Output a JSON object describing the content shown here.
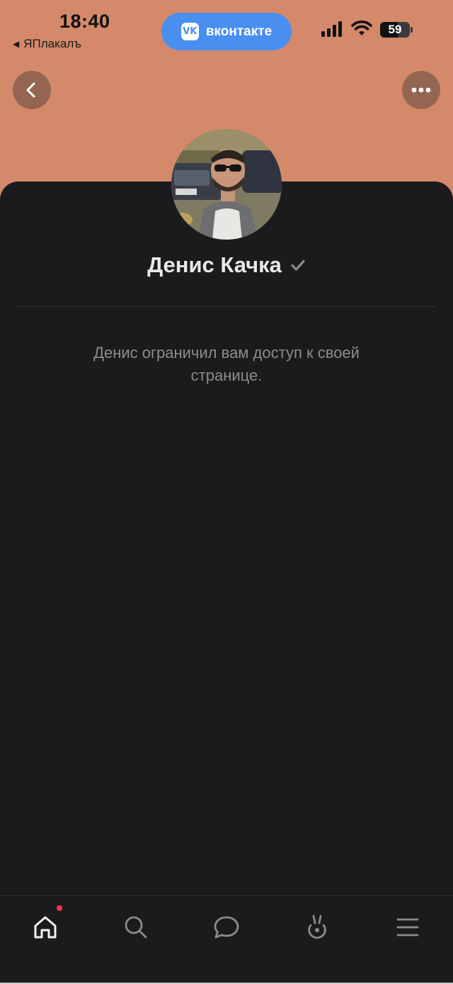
{
  "status_bar": {
    "time": "18:40",
    "back_app": "ЯПлакалъ",
    "app_pill": "вконтакте",
    "battery": "59",
    "battery_level": 0.59
  },
  "header": {
    "back_icon": "chevron-left-icon",
    "more_icon": "more-horizontal-icon",
    "cover_color": "#d4896a"
  },
  "profile": {
    "name": "Денис Качка",
    "verified_icon": "checkmark-icon",
    "notice": "Денис ограничил вам доступ к своей странице."
  },
  "tabbar": {
    "items": [
      {
        "icon": "home-icon",
        "active": true
      },
      {
        "icon": "search-icon",
        "active": false
      },
      {
        "icon": "chat-bubble-icon",
        "active": false
      },
      {
        "icon": "clips-icon",
        "active": false
      },
      {
        "icon": "menu-icon",
        "active": false
      }
    ],
    "badge_color": "#ff3347"
  }
}
